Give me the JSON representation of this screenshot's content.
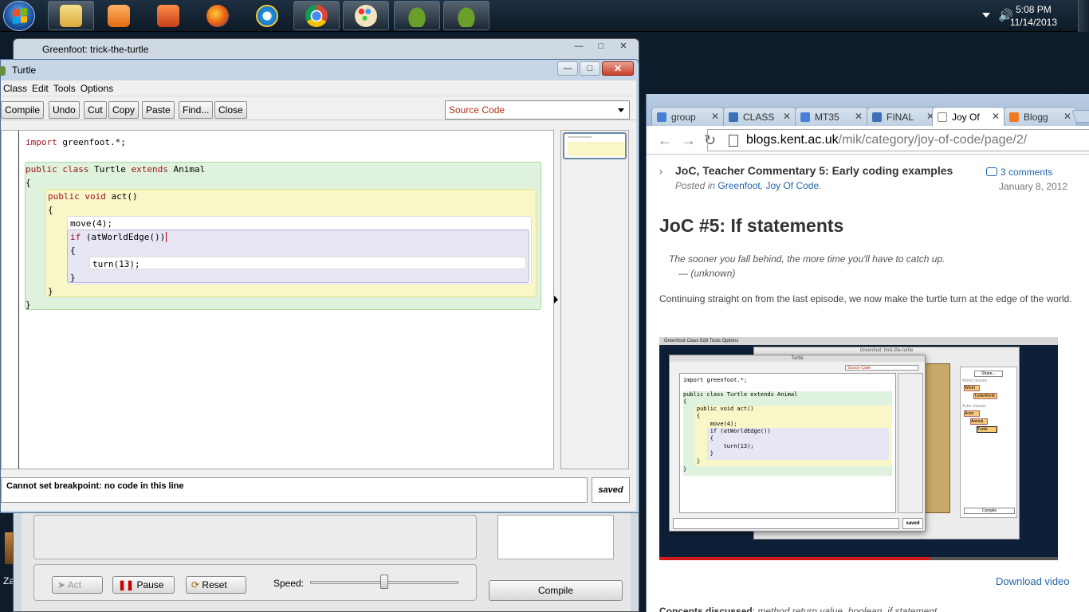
{
  "taskbar": {
    "time": "5:08 PM",
    "date": "11/14/2013",
    "buttons": [
      "file-explorer",
      "media-player",
      "office",
      "firefox",
      "internet-explorer",
      "chrome",
      "paint",
      "greenfoot-1",
      "greenfoot-2"
    ]
  },
  "greenfoot_main": {
    "title": "Greenfoot: trick-the-turtle",
    "act_label": "Act",
    "pause_label": "Pause",
    "reset_label": "Reset",
    "speed_label": "Speed:",
    "speed_value": 0.5,
    "compile_label": "Compile"
  },
  "desktop": {
    "icon_label": "Zap"
  },
  "editor": {
    "title": "Turtle",
    "menu": [
      "Class",
      "Edit",
      "Tools",
      "Options"
    ],
    "toolbar": {
      "compile": "Compile",
      "undo": "Undo",
      "cut": "Cut",
      "copy": "Copy",
      "paste": "Paste",
      "find": "Find...",
      "close": "Close"
    },
    "view_select": "Source Code",
    "code_lines": [
      {
        "kw": "import",
        "rest": " greenfoot.*;"
      },
      {
        "kw": "public class",
        "mid": " Turtle ",
        "kw2": "extends",
        "rest": " Animal"
      },
      {
        "kw": "",
        "rest": "{"
      },
      {
        "kw": "public void",
        "rest": " act()"
      },
      {
        "kw": "",
        "rest": "{"
      },
      {
        "kw": "",
        "rest": "move(4);"
      },
      {
        "kw": "if",
        "rest": " (atWorldEdge())"
      },
      {
        "kw": "",
        "rest": "{"
      },
      {
        "kw": "",
        "rest": "turn(13);"
      },
      {
        "kw": "",
        "rest": "}"
      },
      {
        "kw": "",
        "rest": "}"
      },
      {
        "kw": "",
        "rest": "}"
      }
    ],
    "status_message": "Cannot set breakpoint: no code in this line",
    "saved_label": "saved"
  },
  "browser": {
    "tabs": [
      {
        "label": "group",
        "color": "#4a7fd6"
      },
      {
        "label": "CLASS",
        "color": "#3b6fb6"
      },
      {
        "label": "MT35",
        "color": "#4a7fd6"
      },
      {
        "label": "FINAL",
        "color": "#3b6fb6"
      },
      {
        "label": "Joy Of",
        "color": "#ffffff"
      },
      {
        "label": "Blogg",
        "color": "#f07a22"
      }
    ],
    "url_domain": "blogs.kent.ac.uk",
    "url_path": "/mik/category/joy-of-code/page/2/",
    "post": {
      "title": "JoC, Teacher Commentary 5: Early coding examples",
      "posted_in_label": "Posted in",
      "category1": "Greenfoot",
      "category2": "Joy Of Code",
      "comments": "3 comments",
      "date": "January 8, 2012"
    },
    "heading": "JoC #5: If statements",
    "quote": "The sooner you fall behind, the more time you'll have to catch up.",
    "quote_author": "— (unknown)",
    "paragraph": "Continuing straight on from the last episode, we now make the turtle turn at the edge of the world.",
    "download_label": "Download video",
    "concepts_label": "Concepts discussed",
    "concepts_list": "method return value, boolean, if statement",
    "video_progress": 0.68,
    "video": {
      "menu": "Greenfoot   Class   Edit   Tools   Options",
      "window_title": "Greenfoot: trick-the-turtle",
      "editor_title": "Turtle",
      "source_code": "Source Code",
      "code": [
        "import greenfoot.*;",
        "",
        "public class Turtle extends Animal",
        "{",
        "    public void act()",
        "    {",
        "        move(4);",
        "        if (atWorldEdge())",
        "        {",
        "            turn(13);",
        "        }",
        "    }",
        "}"
      ],
      "saved": "saved",
      "share": "Share...",
      "world_classes": "World classes",
      "world": "World",
      "turtle_world": "TurtleWorld",
      "actor_classes": "Actor classes",
      "actor": "Actor",
      "animal": "Animal",
      "turtle": "Turtle",
      "compile": "Compile"
    }
  },
  "colors": {
    "keyword": "#a0151d",
    "class_block": "#dff2dd",
    "method_block": "#f9f6c8",
    "if_block": "#e6e6f5",
    "link": "#2266aa"
  }
}
